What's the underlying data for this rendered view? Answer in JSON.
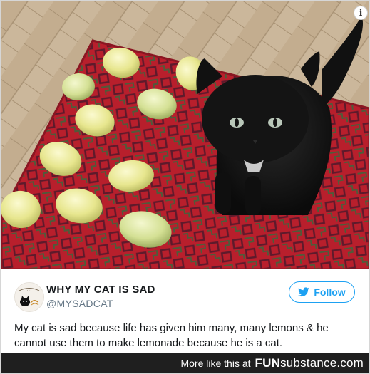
{
  "photo": {
    "alt_icon": "info-icon",
    "info_glyph": "i"
  },
  "tweet": {
    "author_name": "WHY MY CAT IS SAD",
    "author_handle": "@MYSADCAT",
    "follow_label": "Follow",
    "follow_icon": "twitter-bird-icon",
    "text": "My cat is sad because life has given him many, many lemons & he cannot use them to make lemonade because he is a cat.",
    "accent_color": "#1da1f2"
  },
  "footer": {
    "more_text": "More like this at",
    "brand_fun": "FUN",
    "brand_substance": "substance",
    "brand_tld": ".com"
  }
}
